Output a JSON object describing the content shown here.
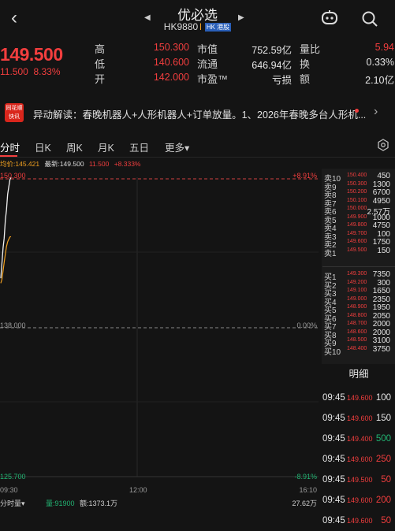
{
  "header": {
    "title": "优必选",
    "code": "HK9880",
    "code_sep": "l",
    "market_tag": "HK 港股"
  },
  "quote": {
    "price": "149.500",
    "change": "11.500",
    "change_pct": "8.33%",
    "stats": [
      {
        "label": "高",
        "value": "150.300",
        "color": "red"
      },
      {
        "label": "市值",
        "value": "752.59亿",
        "color": "white"
      },
      {
        "label": "量比",
        "value": "5.94",
        "color": "red"
      },
      {
        "label": "低",
        "value": "140.600",
        "color": "red"
      },
      {
        "label": "流通",
        "value": "646.94亿",
        "color": "white"
      },
      {
        "label": "换",
        "value": "0.33%",
        "color": "white"
      },
      {
        "label": "开",
        "value": "142.000",
        "color": "red"
      },
      {
        "label": "市盈™",
        "value": "亏损",
        "color": "white"
      },
      {
        "label": "额",
        "value": "2.10亿",
        "color": "white"
      }
    ]
  },
  "news": {
    "badge_top": "同花顺",
    "badge_bottom": "快讯",
    "text": "异动解读：春晚机器人+人形机器人+订单放量。1、2026年春晚多台人形机..."
  },
  "tabs": [
    {
      "label": "分时",
      "active": true
    },
    {
      "label": "日K",
      "active": false
    },
    {
      "label": "周K",
      "active": false
    },
    {
      "label": "月K",
      "active": false
    },
    {
      "label": "五日",
      "active": false
    },
    {
      "label": "更多▾",
      "active": false
    }
  ],
  "chart_info": {
    "avg": "均价:145.421",
    "latest": "最新:149.500",
    "change": "11.500",
    "change_pct": "+8.333%"
  },
  "chart_data": {
    "type": "line",
    "y_top_label": "150.300",
    "y_mid_label": "138.000",
    "y_bottom_label": "125.700",
    "pct_top_label": "+8.91%",
    "pct_mid_label": "0.00%",
    "pct_bottom_label": "-8.91%",
    "ylim": [
      125.7,
      150.3
    ],
    "x_ticks": [
      "09:30",
      "12:00",
      "16:10"
    ],
    "price_series": [
      142.0,
      143.2,
      144.5,
      145.3,
      146.8,
      147.6,
      148.9,
      149.5,
      150.1,
      150.3
    ],
    "avg_series": [
      141.6,
      141.9,
      142.6,
      143.3,
      144.0,
      144.6,
      145.0,
      145.2,
      145.4,
      145.421
    ]
  },
  "volume": {
    "selector": "分时量▾",
    "vol": "量:91900",
    "amount": "额:1373.1万",
    "max": "27.62万"
  },
  "order_book": {
    "asks": [
      {
        "label": "卖10",
        "price": "150.400",
        "vol": "450"
      },
      {
        "label": "卖9",
        "price": "150.300",
        "vol": "1300"
      },
      {
        "label": "卖8",
        "price": "150.200",
        "vol": "6700"
      },
      {
        "label": "卖7",
        "price": "150.100",
        "vol": "4950"
      },
      {
        "label": "卖6",
        "price": "150.000",
        "vol": "2.57万"
      },
      {
        "label": "卖5",
        "price": "149.900",
        "vol": "1000"
      },
      {
        "label": "卖4",
        "price": "149.800",
        "vol": "4750"
      },
      {
        "label": "卖3",
        "price": "149.700",
        "vol": "100"
      },
      {
        "label": "卖2",
        "price": "149.600",
        "vol": "1750"
      },
      {
        "label": "卖1",
        "price": "149.500",
        "vol": "150"
      }
    ],
    "bids": [
      {
        "label": "买1",
        "price": "149.300",
        "vol": "7350"
      },
      {
        "label": "买2",
        "price": "149.200",
        "vol": "300"
      },
      {
        "label": "买3",
        "price": "149.100",
        "vol": "1650"
      },
      {
        "label": "买4",
        "price": "149.000",
        "vol": "2350"
      },
      {
        "label": "买5",
        "price": "148.900",
        "vol": "1950"
      },
      {
        "label": "买6",
        "price": "148.800",
        "vol": "2050"
      },
      {
        "label": "买7",
        "price": "148.700",
        "vol": "2000"
      },
      {
        "label": "买8",
        "price": "148.600",
        "vol": "2000"
      },
      {
        "label": "买9",
        "price": "148.500",
        "vol": "3100"
      },
      {
        "label": "买10",
        "price": "148.400",
        "vol": "3750"
      }
    ]
  },
  "details": {
    "header": "明细",
    "rows": [
      {
        "time": "09:45",
        "price": "149.600",
        "vol": "100",
        "color": "#e6e6e6"
      },
      {
        "time": "09:45",
        "price": "149.600",
        "vol": "150",
        "color": "#e6e6e6"
      },
      {
        "time": "09:45",
        "price": "149.400",
        "vol": "500",
        "color": "#22b573"
      },
      {
        "time": "09:45",
        "price": "149.600",
        "vol": "250",
        "color": "#f23e3e"
      },
      {
        "time": "09:45",
        "price": "149.500",
        "vol": "50",
        "color": "#f23e3e"
      },
      {
        "time": "09:45",
        "price": "149.600",
        "vol": "200",
        "color": "#f23e3e"
      },
      {
        "time": "09:45",
        "price": "149.600",
        "vol": "50",
        "color": "#f23e3e"
      }
    ]
  }
}
